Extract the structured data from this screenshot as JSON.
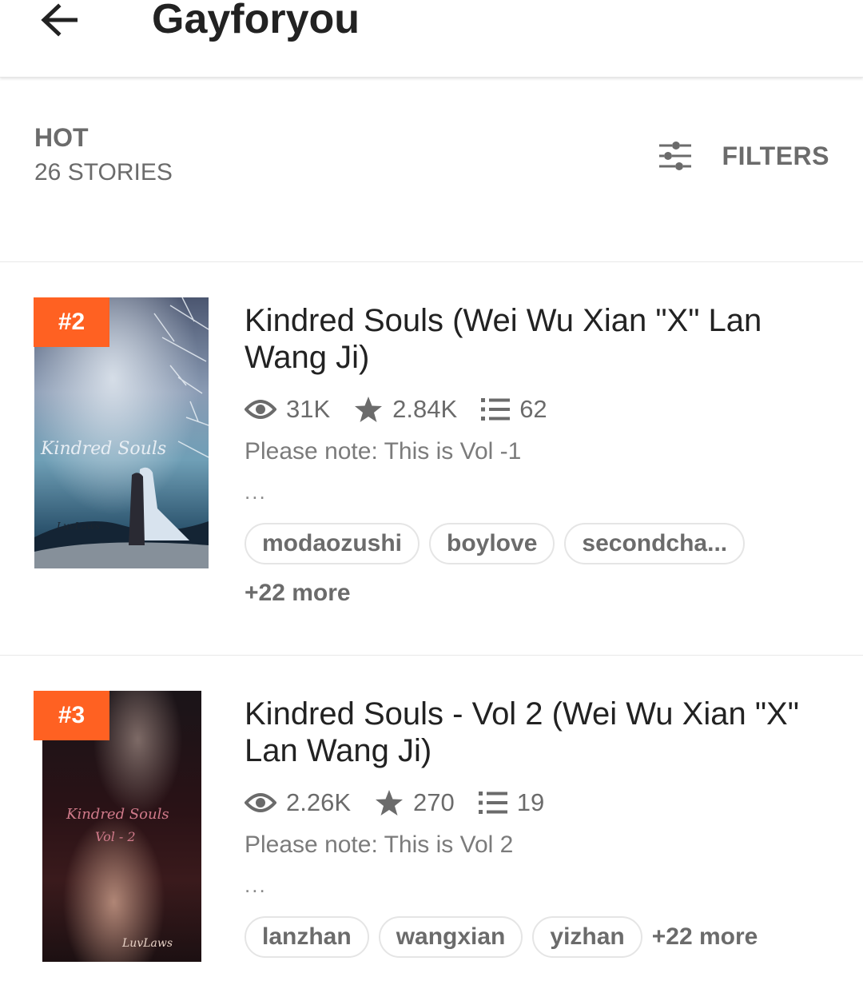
{
  "header": {
    "title": "Gayforyou"
  },
  "list": {
    "sort_label": "HOT",
    "count_label": "26 STORIES",
    "filters_label": "FILTERS"
  },
  "stories": [
    {
      "rank": "#2",
      "title": "Kindred Souls (Wei Wu Xian \"X\" Lan Wang Ji)",
      "cover_text": "Kindred Souls",
      "cover_author": "LuvLaws",
      "views": "31K",
      "votes": "2.84K",
      "parts": "62",
      "description": "Please note: This is Vol -1",
      "ellipsis": "...",
      "tags": [
        "modaozushi",
        "boylove",
        "secondcha..."
      ],
      "more": "+22 more"
    },
    {
      "rank": "#3",
      "title": "Kindred Souls - Vol 2 (Wei Wu Xian \"X\" Lan Wang Ji)",
      "cover_text": "Kindred Souls",
      "cover_subtext": "Vol - 2",
      "cover_author": "LuvLaws",
      "views": "2.26K",
      "votes": "270",
      "parts": "19",
      "description": "Please note: This is Vol 2",
      "ellipsis": "...",
      "tags": [
        "lanzhan",
        "wangxian",
        "yizhan"
      ],
      "more": "+22 more"
    }
  ],
  "colors": {
    "accent": "#ff6122",
    "text_primary": "#222222",
    "text_secondary": "#6b6b6b"
  },
  "icons": {
    "back": "arrow-left-icon",
    "filters": "sliders-icon",
    "views": "eye-icon",
    "votes": "star-icon",
    "parts": "list-icon"
  }
}
